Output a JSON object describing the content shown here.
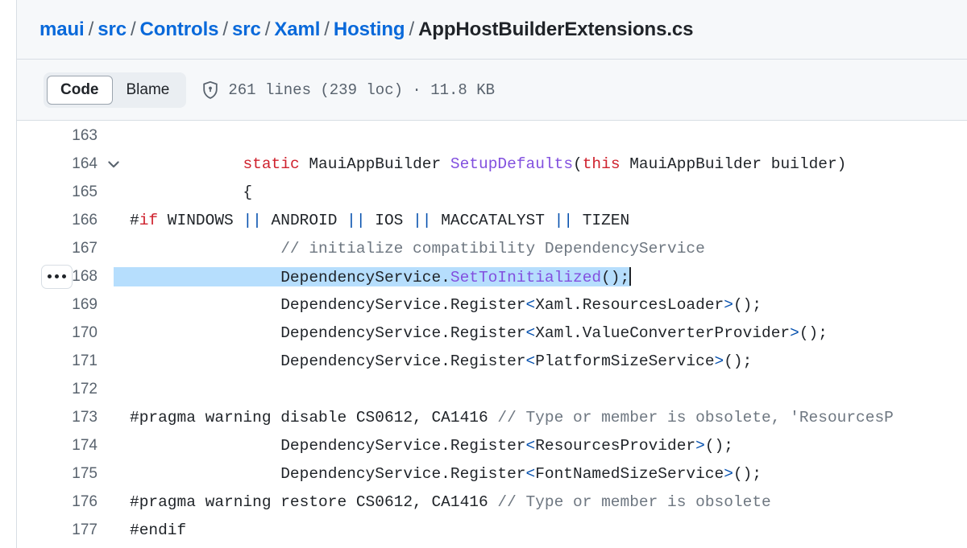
{
  "breadcrumb": {
    "separator": "/",
    "crumbs": [
      {
        "label": "maui",
        "link": true
      },
      {
        "label": "src",
        "link": true
      },
      {
        "label": "Controls",
        "link": true
      },
      {
        "label": "src",
        "link": true
      },
      {
        "label": "Xaml",
        "link": true
      },
      {
        "label": "Hosting",
        "link": true
      },
      {
        "label": "AppHostBuilderExtensions.cs",
        "link": false
      }
    ]
  },
  "toolbar": {
    "tabs": [
      {
        "label": "Code",
        "active": true
      },
      {
        "label": "Blame",
        "active": false
      }
    ],
    "security_icon": "shield-lock-icon",
    "file_stats": "261 lines (239 loc) · 11.8 KB",
    "lines_count": "261",
    "loc_count": "239",
    "file_size": "11.8 KB"
  },
  "colors": {
    "link": "#0969da",
    "keyword": "#cf222e",
    "function": "#8250df",
    "operator": "#0550ae",
    "comment": "#6e7781",
    "selection": "#b6defd",
    "header_bg": "#f6f8fa",
    "border": "#d8dee4",
    "line_number": "#59636e"
  },
  "code": {
    "lines": [
      {
        "num": "163",
        "collapsible": false,
        "kebab": false,
        "highlighted": false,
        "tokens": []
      },
      {
        "num": "164",
        "collapsible": true,
        "kebab": false,
        "highlighted": false,
        "tokens": [
          {
            "t": "            ",
            "c": "plain"
          },
          {
            "t": "static",
            "c": "kw"
          },
          {
            "t": " MauiAppBuilder ",
            "c": "plain"
          },
          {
            "t": "SetupDefaults",
            "c": "fn"
          },
          {
            "t": "(",
            "c": "plain"
          },
          {
            "t": "this",
            "c": "kw"
          },
          {
            "t": " MauiAppBuilder builder)",
            "c": "plain"
          }
        ]
      },
      {
        "num": "165",
        "collapsible": false,
        "kebab": false,
        "highlighted": false,
        "tokens": [
          {
            "t": "            {",
            "c": "plain"
          }
        ]
      },
      {
        "num": "166",
        "collapsible": false,
        "kebab": false,
        "highlighted": false,
        "tokens": [
          {
            "t": "#",
            "c": "plain"
          },
          {
            "t": "if",
            "c": "kw"
          },
          {
            "t": " WINDOWS ",
            "c": "plain"
          },
          {
            "t": "||",
            "c": "op"
          },
          {
            "t": " ANDROID ",
            "c": "plain"
          },
          {
            "t": "||",
            "c": "op"
          },
          {
            "t": " IOS ",
            "c": "plain"
          },
          {
            "t": "||",
            "c": "op"
          },
          {
            "t": " MACCATALYST ",
            "c": "plain"
          },
          {
            "t": "||",
            "c": "op"
          },
          {
            "t": " TIZEN",
            "c": "plain"
          }
        ]
      },
      {
        "num": "167",
        "collapsible": false,
        "kebab": false,
        "highlighted": false,
        "tokens": [
          {
            "t": "                ",
            "c": "plain"
          },
          {
            "t": "// initialize compatibility DependencyService",
            "c": "comment"
          }
        ]
      },
      {
        "num": "168",
        "collapsible": false,
        "kebab": true,
        "highlighted": true,
        "caret": true,
        "tokens": [
          {
            "t": "                ",
            "c": "plain"
          },
          {
            "t": "DependencyService.",
            "c": "plain"
          },
          {
            "t": "SetToInitialized",
            "c": "fn"
          },
          {
            "t": "();",
            "c": "plain"
          }
        ]
      },
      {
        "num": "169",
        "collapsible": false,
        "kebab": false,
        "highlighted": false,
        "tokens": [
          {
            "t": "                DependencyService.Register",
            "c": "plain"
          },
          {
            "t": "<",
            "c": "op"
          },
          {
            "t": "Xaml.ResourcesLoader",
            "c": "plain"
          },
          {
            "t": ">",
            "c": "op"
          },
          {
            "t": "();",
            "c": "plain"
          }
        ]
      },
      {
        "num": "170",
        "collapsible": false,
        "kebab": false,
        "highlighted": false,
        "tokens": [
          {
            "t": "                DependencyService.Register",
            "c": "plain"
          },
          {
            "t": "<",
            "c": "op"
          },
          {
            "t": "Xaml.ValueConverterProvider",
            "c": "plain"
          },
          {
            "t": ">",
            "c": "op"
          },
          {
            "t": "();",
            "c": "plain"
          }
        ]
      },
      {
        "num": "171",
        "collapsible": false,
        "kebab": false,
        "highlighted": false,
        "tokens": [
          {
            "t": "                DependencyService.Register",
            "c": "plain"
          },
          {
            "t": "<",
            "c": "op"
          },
          {
            "t": "PlatformSizeService",
            "c": "plain"
          },
          {
            "t": ">",
            "c": "op"
          },
          {
            "t": "();",
            "c": "plain"
          }
        ]
      },
      {
        "num": "172",
        "collapsible": false,
        "kebab": false,
        "highlighted": false,
        "tokens": []
      },
      {
        "num": "173",
        "collapsible": false,
        "kebab": false,
        "highlighted": false,
        "tokens": [
          {
            "t": "#pragma warning disable CS0612, CA1416 ",
            "c": "plain"
          },
          {
            "t": "// Type or member is obsolete, 'ResourcesP",
            "c": "comment"
          }
        ]
      },
      {
        "num": "174",
        "collapsible": false,
        "kebab": false,
        "highlighted": false,
        "tokens": [
          {
            "t": "                DependencyService.Register",
            "c": "plain"
          },
          {
            "t": "<",
            "c": "op"
          },
          {
            "t": "ResourcesProvider",
            "c": "plain"
          },
          {
            "t": ">",
            "c": "op"
          },
          {
            "t": "();",
            "c": "plain"
          }
        ]
      },
      {
        "num": "175",
        "collapsible": false,
        "kebab": false,
        "highlighted": false,
        "tokens": [
          {
            "t": "                DependencyService.Register",
            "c": "plain"
          },
          {
            "t": "<",
            "c": "op"
          },
          {
            "t": "FontNamedSizeService",
            "c": "plain"
          },
          {
            "t": ">",
            "c": "op"
          },
          {
            "t": "();",
            "c": "plain"
          }
        ]
      },
      {
        "num": "176",
        "collapsible": false,
        "kebab": false,
        "highlighted": false,
        "tokens": [
          {
            "t": "#pragma warning restore CS0612, CA1416 ",
            "c": "plain"
          },
          {
            "t": "// Type or member is obsolete",
            "c": "comment"
          }
        ]
      },
      {
        "num": "177",
        "collapsible": false,
        "kebab": false,
        "highlighted": false,
        "tokens": [
          {
            "t": "#endif",
            "c": "plain"
          }
        ]
      }
    ]
  }
}
